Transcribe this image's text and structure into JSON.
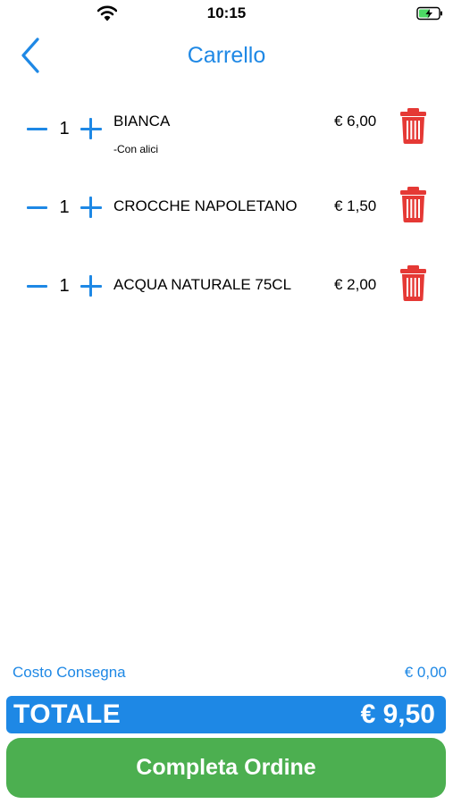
{
  "status_bar": {
    "time": "10:15",
    "wifi_icon": "wifi-icon",
    "battery_icon": "battery-charging-icon"
  },
  "nav": {
    "back_icon": "chevron-left-icon",
    "title": "Carrello"
  },
  "colors": {
    "accent": "#1E88E5",
    "delete": "#E53935",
    "confirm": "#4CAF50",
    "text": "#000000"
  },
  "cart": {
    "items": [
      {
        "quantity": "1",
        "name": "BIANCA",
        "note": "-Con alici",
        "price": "€ 6,00"
      },
      {
        "quantity": "1",
        "name": "CROCCHE NAPOLETANO",
        "note": "",
        "price": "€ 1,50"
      },
      {
        "quantity": "1",
        "name": "ACQUA NATURALE 75CL",
        "note": "",
        "price": "€ 2,00"
      }
    ],
    "decrement_icon": "minus-icon",
    "increment_icon": "plus-icon",
    "delete_icon": "trash-icon"
  },
  "summary": {
    "delivery_label": "Costo Consegna",
    "delivery_value": "€ 0,00",
    "total_label": "TOTALE",
    "total_value": "€ 9,50"
  },
  "actions": {
    "complete_label": "Completa Ordine"
  }
}
